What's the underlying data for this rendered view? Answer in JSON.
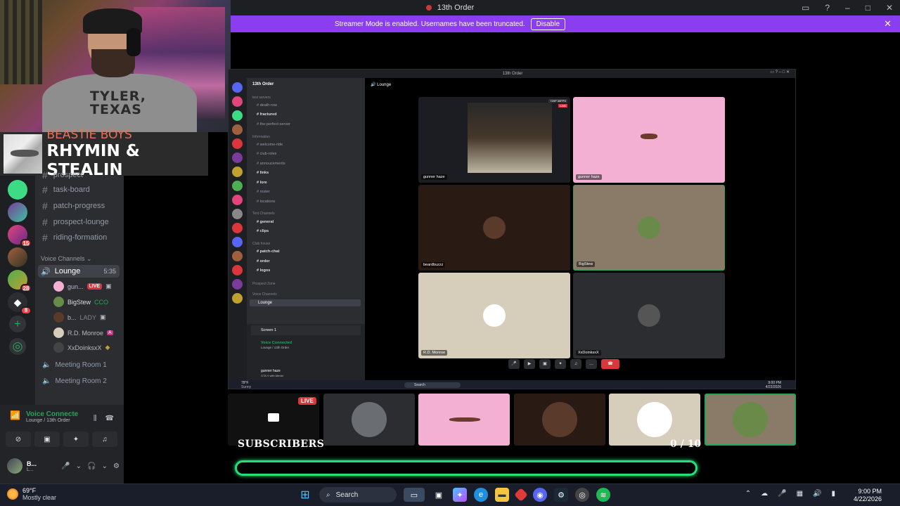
{
  "window": {
    "title": "13th Order"
  },
  "banner": {
    "text": "Streamer Mode is enabled. Usernames have been truncated.",
    "disable_label": "Disable"
  },
  "webcam": {
    "shirt_line1": "TYLER,",
    "shirt_line2": "TEXAS"
  },
  "now_playing": {
    "artist": "BEASTIE BOYS",
    "title": "RHYMIN & STEALIN"
  },
  "rail_badges": {
    "b1": "15",
    "b2": "28",
    "b3": "8"
  },
  "channels": {
    "partial": "prospect",
    "items": [
      "task-board",
      "patch-progress",
      "prospect-lounge",
      "riding-formation"
    ],
    "voice_category": "Voice Channels",
    "lounge": {
      "name": "Lounge",
      "time": "5:35"
    },
    "voice_users": [
      {
        "name": "gun...",
        "live": "LIVE",
        "color": "#f3b0d2"
      },
      {
        "name": "BigStew",
        "extra": "CCO",
        "color": "#6a8a4a"
      },
      {
        "name": "b...",
        "extra": "LADY",
        "color": "#5a3a2a"
      },
      {
        "name": "R.D. Monroe",
        "color": "#d7cdbb"
      },
      {
        "name": "XxDoinksxX",
        "color": "#444"
      }
    ],
    "meeting_rooms": [
      "Meeting Room 1",
      "Meeting Room 2"
    ]
  },
  "voice_panel": {
    "title": "Voice Connecte",
    "subtitle": "Lounge / 13th Order",
    "user_name": "B...",
    "user_status": "L..."
  },
  "mini": {
    "title": "13th Order",
    "server_name": "13th Order",
    "header": "Lounge",
    "cat_test": "test servers",
    "test_items": [
      "death-row",
      "fractured",
      "the-perfect-server"
    ],
    "cat_info": "Information",
    "info_items": [
      "welcome-ride",
      "club-roles",
      "annoucements",
      "links",
      "lore",
      "roster",
      "locations"
    ],
    "cat_text": "Text Channels",
    "text_items": [
      "general",
      "clips"
    ],
    "cat_club": "Club house",
    "club_items": [
      "patch-chat",
      "order",
      "logos"
    ],
    "cat_prospect": "Prospect Zone",
    "cat_voice": "Voice Channels",
    "lounge": "Lounge",
    "screen": "Screen 1",
    "vc": "Voice Connected",
    "vc_sub": "Lounge / 13th Order",
    "user": "gunner haze",
    "user_status": "GTA V with Medal",
    "tiles": [
      "gunner haze",
      "gunner haze",
      "beardbuzzz",
      "BigStew",
      "R.D. Monroe",
      "XxDoinksxX"
    ],
    "tile_badge": "720P 30FPS",
    "tile_live": "LIVE",
    "task_search": "Search",
    "task_weather": "78°F",
    "task_weather2": "Sunny",
    "task_time": "9:00 PM",
    "task_date": "4/22/2026"
  },
  "subs": {
    "label": "SUBSCRIBERS",
    "count": "0 / 10",
    "live": "LIVE",
    "progress": 0.0
  },
  "taskbar": {
    "temp": "69°F",
    "weather": "Mostly clear",
    "search": "Search",
    "time": "9:00 PM",
    "date": "4/22/2026"
  },
  "colors": {
    "accent": "#8b3df0",
    "green": "#23a55a",
    "live": "#da373c",
    "progress": "#24e07a"
  }
}
